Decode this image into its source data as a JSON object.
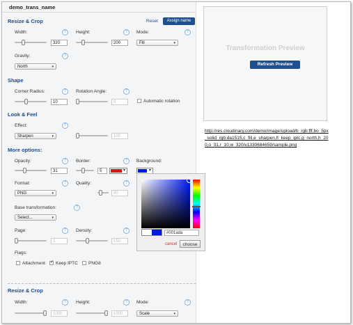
{
  "header": {
    "title": "demo_trans_name"
  },
  "resize": {
    "section": "Resize & Crop",
    "reset_label": "Reset",
    "assign_label": "Assign name",
    "width_label": "Width:",
    "width_value": "320",
    "height_label": "Height:",
    "height_value": "200",
    "mode_label": "Mode:",
    "mode_value": "Fill",
    "gravity_label": "Gravity:",
    "gravity_value": "North"
  },
  "shape": {
    "section": "Shape",
    "corner_label": "Corner Radius:",
    "corner_value": "10",
    "rotation_label": "Rotation Angle:",
    "rotation_value": "0",
    "auto_rotation_label": "Automatic rotation"
  },
  "look": {
    "section": "Look & Feel",
    "effect_label": "Effect:",
    "effect_value": "Sharpen",
    "effect_amount": "100"
  },
  "more": {
    "section": "More options:",
    "opacity_label": "Opacity:",
    "opacity_value": "31",
    "border_label": "Border:",
    "border_value": "5",
    "border_color": "#da1515",
    "background_label": "Background:",
    "background_color": "#001ada",
    "format_label": "Format:",
    "format_value": "PNG",
    "quality_label": "Quality:",
    "quality_value": "80",
    "base_label": "Base transformation:",
    "base_value": "Select...",
    "page_label": "Page:",
    "page_value": "1",
    "density_label": "Density:",
    "density_value": "150",
    "flags_label": "Flags:",
    "flags": [
      {
        "label": "Attachment",
        "checked": false
      },
      {
        "label": "Keep IPTC",
        "checked": true
      },
      {
        "label": "PNG8",
        "checked": false
      }
    ]
  },
  "picker": {
    "hex_value": "#001ada",
    "cancel_label": "cancel",
    "choose_label": "choose"
  },
  "resize2": {
    "section": "Resize & Crop",
    "width_label": "Width:",
    "width_value": "1000",
    "height_label": "Height:",
    "height_value": "1000",
    "mode_label": "Mode:",
    "mode_value": "Scale"
  },
  "preview": {
    "title": "Transformation Preview",
    "refresh_label": "Refresh Preview",
    "url": "http://res.cloudinary.com/demo/image/upload/b_rgb:fff,bo_5px_solid_rgb:da1515,c_fill,e_sharpen,fl_keep_iptc,g_north,h_200,o_31,r_10,w_320/v1330684659/sample.png"
  }
}
